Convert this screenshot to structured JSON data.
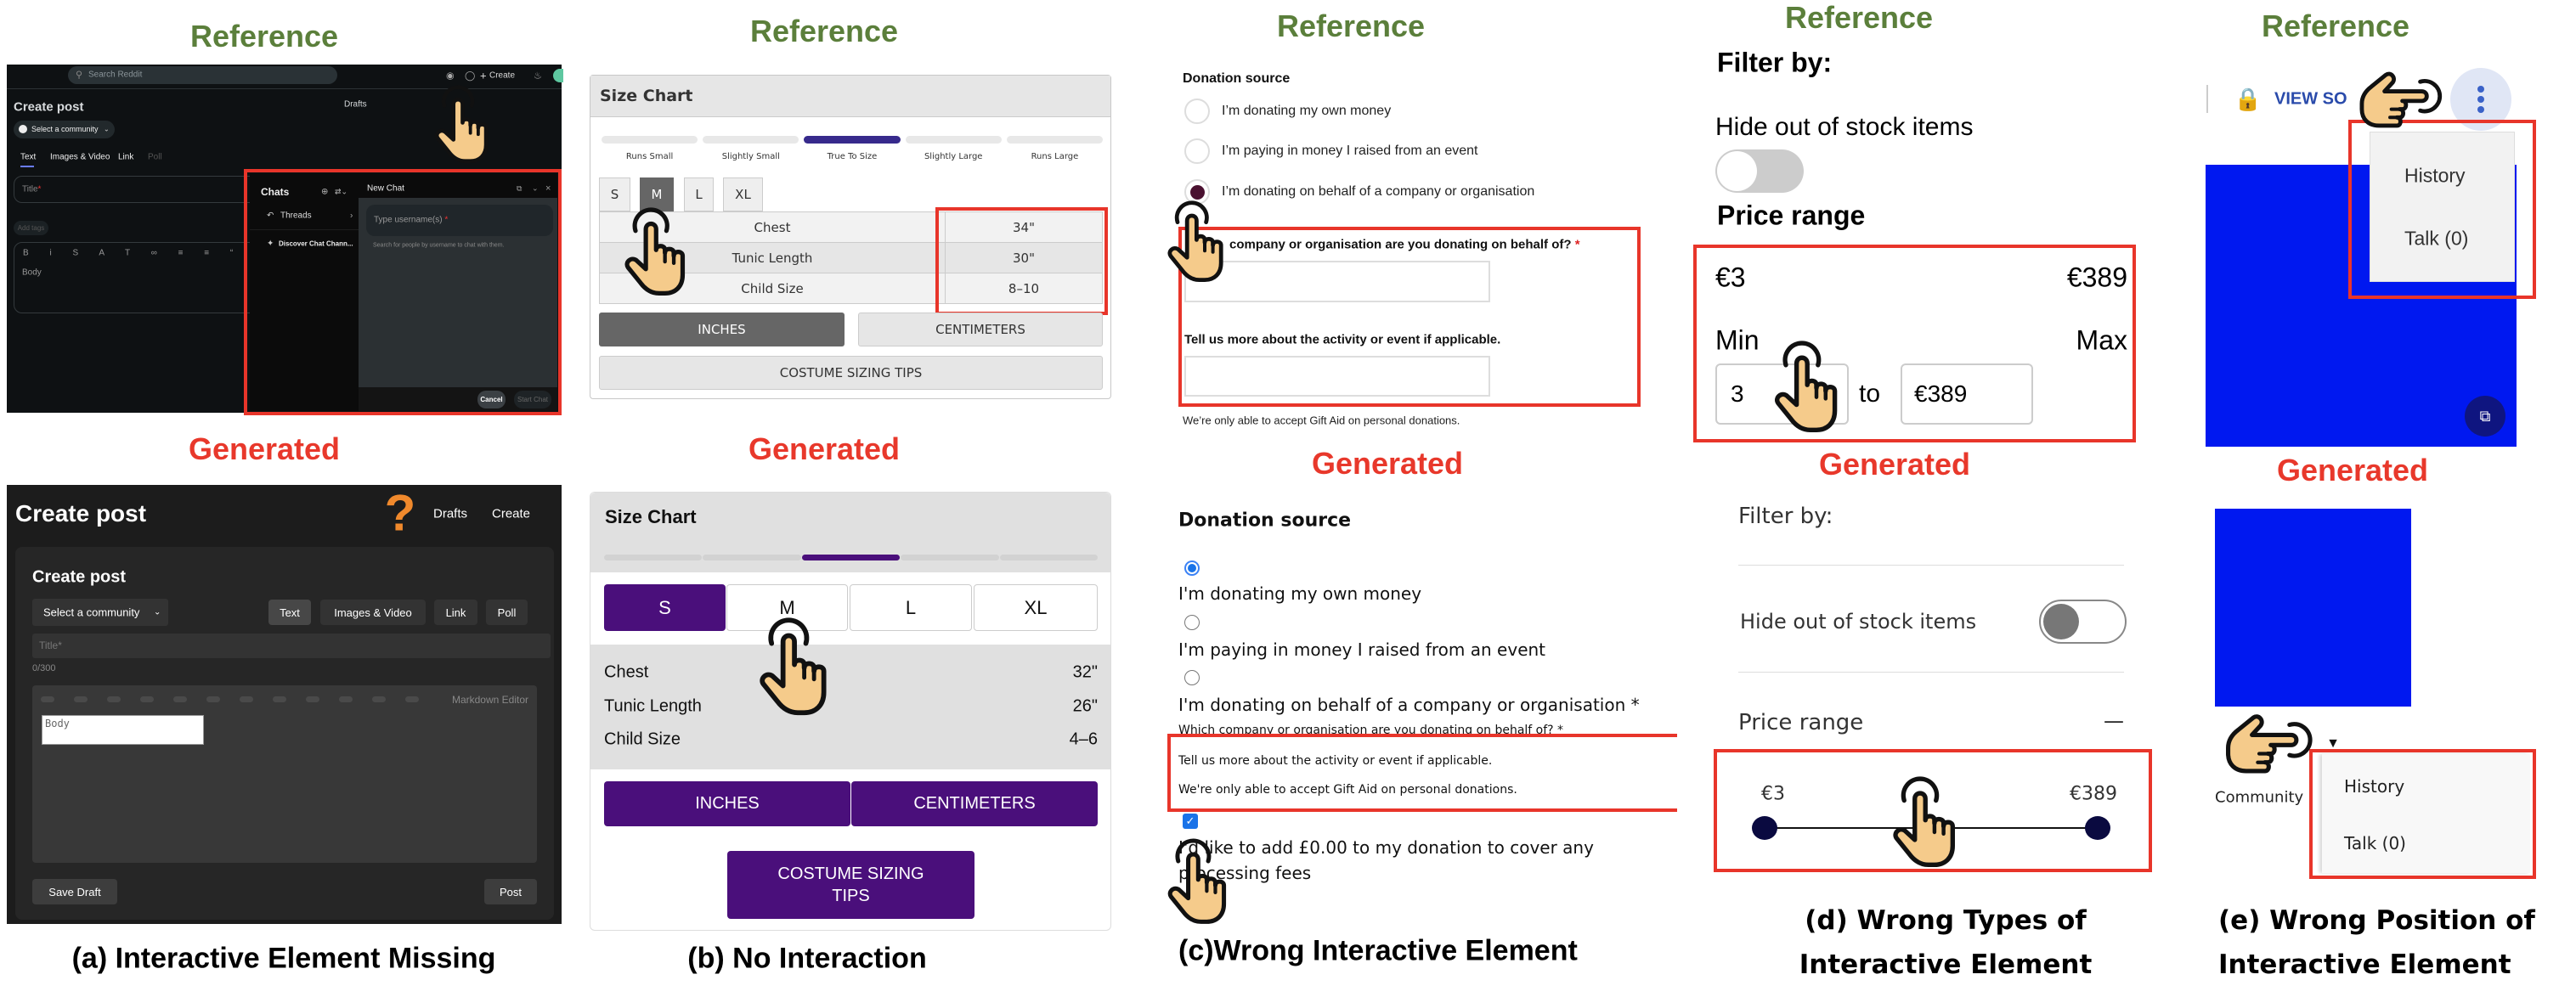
{
  "labels": {
    "reference": "Reference",
    "generated": "Generated"
  },
  "colors": {
    "reference_label": "#5B7F3B",
    "generated_label": "#E8382B",
    "highlight_box": "#E8352A",
    "hand": "#F5CB8B"
  },
  "panel_a": {
    "caption": "(a) Interactive Element Missing",
    "reference": {
      "search_placeholder": "Search Reddit",
      "create_label": "Create",
      "title": "Create post",
      "drafts": "Drafts",
      "community_select": "Select a community",
      "tabs": [
        "Text",
        "Images & Video",
        "Link",
        "Poll"
      ],
      "title_placeholder": "Title",
      "required_mark": "*",
      "add_tags": "Add tags",
      "body_placeholder": "Body",
      "chat": {
        "chats_title": "Chats",
        "threads": "Threads",
        "discover": "Discover Chat Chann...",
        "new_chat_title": "New Chat",
        "username_placeholder": "Type username(s)",
        "helper": "Search for people by username to chat with them.",
        "cancel": "Cancel",
        "start_chat": "Start Chat"
      }
    },
    "generated": {
      "missing_marker": "?",
      "header_title": "Create post",
      "drafts": "Drafts",
      "create": "Create",
      "card_title": "Create post",
      "community_select": "Select a community",
      "tabs": [
        "Text",
        "Images & Video",
        "Link",
        "Poll"
      ],
      "title_placeholder": "Title*",
      "counter": "0/300",
      "markdown_editor": "Markdown Editor",
      "body_placeholder": "Body",
      "save_draft": "Save Draft",
      "post": "Post"
    }
  },
  "panel_b": {
    "caption": "(b) No Interaction",
    "reference": {
      "title": "Size Chart",
      "fit_scale": [
        "Runs Small",
        "Slightly Small",
        "True To Size",
        "Slightly Large",
        "Runs Large"
      ],
      "fit_selected": "True To Size",
      "sizes": [
        "S",
        "M",
        "L",
        "XL"
      ],
      "selected_size": "M",
      "rows": [
        {
          "label": "Chest",
          "value": "34\""
        },
        {
          "label": "Tunic Length",
          "value": "30\""
        },
        {
          "label": "Child Size",
          "value": "8–10"
        }
      ],
      "inches": "INCHES",
      "centimeters": "CENTIMETERS",
      "tips": "COSTUME SIZING TIPS",
      "accent": "#372A8C"
    },
    "generated": {
      "title": "Size Chart",
      "sizes": [
        "S",
        "M",
        "L",
        "XL"
      ],
      "selected_size": "S",
      "rows": [
        {
          "label": "Chest",
          "value": "32\""
        },
        {
          "label": "Tunic Length",
          "value": "26\""
        },
        {
          "label": "Child Size",
          "value": "4–6"
        }
      ],
      "inches": "INCHES",
      "centimeters": "CENTIMETERS",
      "tips": "COSTUME SIZING TIPS",
      "accent": "#4A0F7B"
    }
  },
  "panel_c": {
    "caption": "(c)Wrong Interactive Element",
    "reference": {
      "heading": "Donation source",
      "options": [
        "I’m donating my own money",
        "I’m paying in money I raised from an event",
        "I’m donating on behalf of a company or organisation"
      ],
      "selected_index": 2,
      "company_question": "company or organisation are you donating on behalf of?",
      "required_mark": "*",
      "activity_question": "Tell us more about the activity or event if applicable.",
      "gift_aid_note": "We’re only able to accept Gift Aid on personal donations."
    },
    "generated": {
      "heading": "Donation source",
      "options": [
        "I'm donating my own money",
        "I'm paying in money I raised from an event",
        "I'm donating on behalf of a company or organisation *"
      ],
      "selected_index": 0,
      "company_question": "Which company or organisation are you donating on behalf of? *",
      "activity_question": "Tell us more about the activity or event if applicable.",
      "gift_aid_note": "We're only able to accept Gift Aid on personal donations.",
      "fee_checkbox_checked": true,
      "fee_line1": "I'd like to add £0.00 to my donation to cover any",
      "fee_line2": "processing fees"
    }
  },
  "panel_d": {
    "caption_line1": "(d) Wrong Types of",
    "caption_line2": "Interactive Element",
    "reference": {
      "filter_by": "Filter by:",
      "hide_out_of_stock": "Hide out of stock items",
      "toggle_on": false,
      "price_range": "Price range",
      "min_price": "€3",
      "max_price": "€389",
      "min_label": "Min",
      "max_label": "Max",
      "min_value": "3",
      "to": "to",
      "max_value": "€389"
    },
    "generated": {
      "filter_by": "Filter by:",
      "hide_out_of_stock": "Hide out of stock items",
      "toggle_on": false,
      "price_range": "Price range",
      "collapse_symbol": "—",
      "min_price": "€3",
      "max_price": "€389"
    }
  },
  "panel_e": {
    "caption_line1": "(e) Wrong Position of",
    "caption_line2": "Interactive Element",
    "reference": {
      "view_source": "VIEW SO",
      "menu_items": [
        "History",
        "Talk (0)"
      ],
      "image_color": "#0018F0"
    },
    "generated": {
      "dropdown_arrow": "▼",
      "community": "Community",
      "menu_items": [
        "History",
        "Talk (0)"
      ],
      "image_color": "#0018F0"
    }
  }
}
